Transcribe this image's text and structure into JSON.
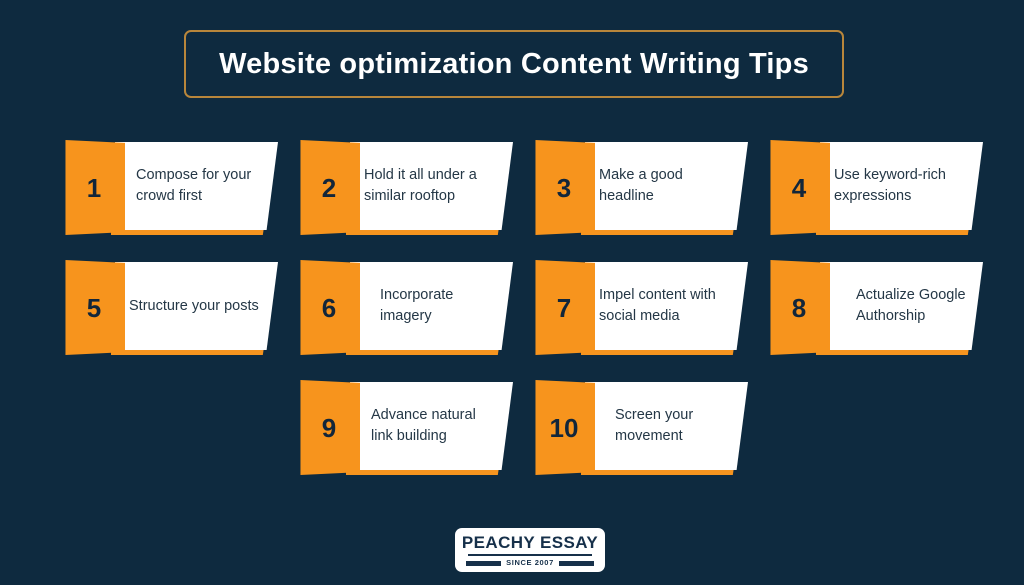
{
  "colors": {
    "background": "#0e2a3f",
    "accent_orange": "#f7941d",
    "accent_orange_shadow": "#f5941f",
    "title_border_gold": "#b8863b",
    "panel_white": "#ffffff",
    "text_dark": "#243746",
    "number_dark": "#12263a"
  },
  "title": {
    "text": "Website optimization Content Writing Tips"
  },
  "cards": [
    {
      "number": "1",
      "label": "Compose for your crowd first"
    },
    {
      "number": "2",
      "label": "Hold it all under a similar rooftop"
    },
    {
      "number": "3",
      "label": "Make a good headline"
    },
    {
      "number": "4",
      "label": "Use keyword-rich expressions"
    },
    {
      "number": "5",
      "label": "Structure your posts"
    },
    {
      "number": "6",
      "label": "Incorporate imagery"
    },
    {
      "number": "7",
      "label": "Impel content with social media"
    },
    {
      "number": "8",
      "label": "Actualize Google Authorship"
    },
    {
      "number": "9",
      "label": "Advance natural link building"
    },
    {
      "number": "10",
      "label": "Screen your movement"
    }
  ],
  "logo": {
    "name": "PEACHY ESSAY",
    "since": "SINCE 2007"
  }
}
